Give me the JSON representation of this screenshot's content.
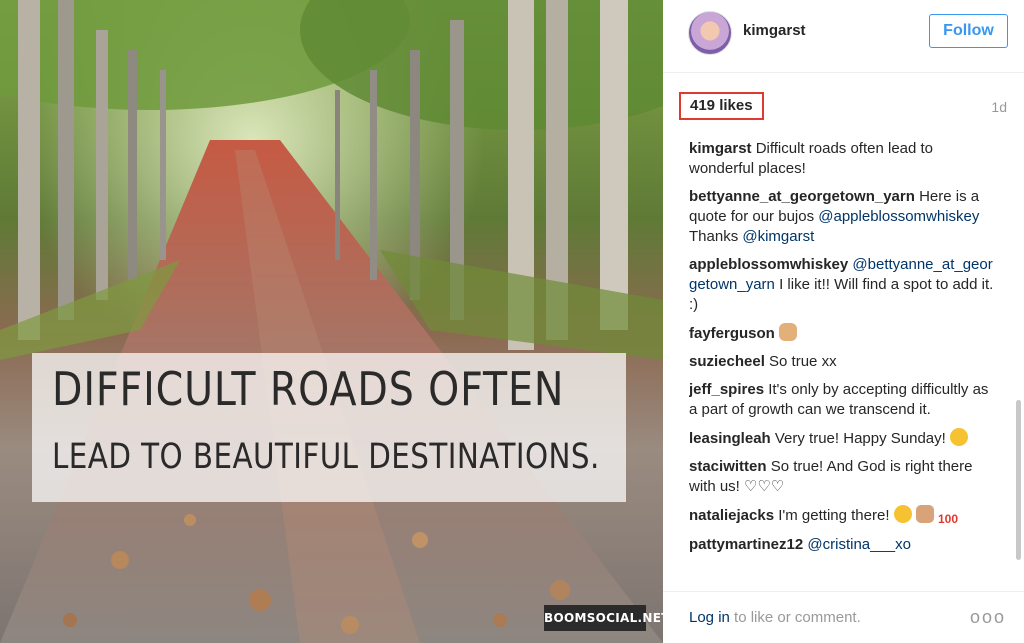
{
  "post": {
    "quote_line1": "DIFFICULT ROADS OFTEN",
    "quote_line2": "LEAD TO BEAUTIFUL DESTINATIONS.",
    "watermark": "BOOMSOCIAL.NET"
  },
  "header": {
    "username": "kimgarst",
    "follow_label": "Follow"
  },
  "likes": {
    "label": "419 likes",
    "timestamp": "1d"
  },
  "comments": [
    {
      "user": "kimgarst",
      "text": " Difficult roads often lead to wonderful places!"
    },
    {
      "user": "bettyanne_at_georgetown_yarn",
      "text": " Here is a quote for our bujos ",
      "mention1": "@appleblossomwhiskey",
      "text2": " Thanks ",
      "mention2": "@kimgarst"
    },
    {
      "user": "appleblossomwhiskey",
      "mention1": " @bettyanne_at_georgetown_yarn",
      "text": " I like it!! Will find a spot to add it. :)"
    },
    {
      "user": "fayferguson",
      "text": " "
    },
    {
      "user": "suziecheel",
      "text": " So true xx"
    },
    {
      "user": "jeff_spires",
      "text": " It's only by accepting difficultly as a part of growth can we transcend it."
    },
    {
      "user": "leasingleah",
      "text": " Very true! Happy Sunday! "
    },
    {
      "user": "staciwitten",
      "text": " So true! And God is right there with us! ♡♡♡"
    },
    {
      "user": "nataliejacks",
      "text": " I'm getting there! "
    },
    {
      "user": "pattymartinez12",
      "mention1": " @cristina___xo"
    }
  ],
  "footer": {
    "login_label": "Log in",
    "rest_label": " to like or comment.",
    "more_label": "ooo"
  },
  "icons": {
    "hands": "raised-hands-emoji-icon",
    "smile": "smiling-face-emoji-icon",
    "sweat": "grinning-sweat-emoji-icon",
    "arm": "flexed-biceps-emoji-icon",
    "hundred": "hundred-points-emoji-icon"
  },
  "colors": {
    "link": "#003569",
    "accent": "#3897f0",
    "highlight_border": "#e0392f"
  }
}
